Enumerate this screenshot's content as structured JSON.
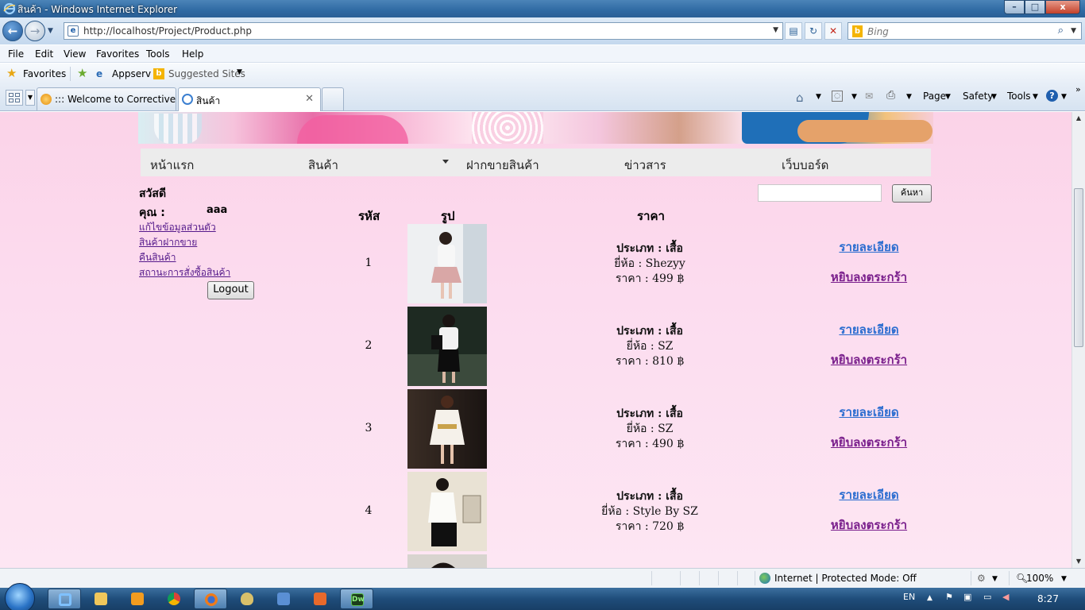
{
  "window": {
    "title": "สินค้า - Windows Internet Explorer",
    "min": "–",
    "max": "□",
    "close": "x"
  },
  "address": {
    "url": "http://localhost/Project/Product.php",
    "search_placeholder": "Bing"
  },
  "menu": [
    "File",
    "Edit",
    "View",
    "Favorites",
    "Tools",
    "Help"
  ],
  "favorites": {
    "label": "Favorites",
    "items": [
      "Appserv",
      "Suggested Sites"
    ]
  },
  "tabs": [
    {
      "label": "::: Welcome to Corrective ...",
      "active": false
    },
    {
      "label": "สินค้า",
      "active": true
    }
  ],
  "commandbar": {
    "page": "Page",
    "safety": "Safety",
    "tools": "Tools"
  },
  "site": {
    "nav": [
      "หน้าแรก",
      "สินค้า",
      "ฝากขายสินค้า",
      "ข่าวสาร",
      "เว็บบอร์ด"
    ],
    "greeting": "สวัสดี",
    "user_label": "คุณ :",
    "username": "aaa",
    "links": [
      "แก้ไขข้อมูลส่วนตัว",
      "สินค้าฝากขาย",
      "คืนสินค้า",
      "สถานะการสั่งซื้อสินค้า"
    ],
    "logout": "Logout",
    "search_button": "ค้นหา",
    "columns": [
      "รหัส",
      "รูป",
      "ราคา"
    ],
    "detail_label": "รายละเอียด",
    "cart_label": "หยิบลงตระกร้า",
    "products": [
      {
        "id": "1",
        "type": "ประเภท : เสื้อ",
        "brand": "ยี่ห้อ : Shezyy",
        "price": "ราคา : 499 ฿"
      },
      {
        "id": "2",
        "type": "ประเภท : เสื้อ",
        "brand": "ยี่ห้อ : SZ",
        "price": "ราคา : 810 ฿"
      },
      {
        "id": "3",
        "type": "ประเภท : เสื้อ",
        "brand": "ยี่ห้อ : SZ",
        "price": "ราคา : 490 ฿"
      },
      {
        "id": "4",
        "type": "ประเภท : เสื้อ",
        "brand": "ยี่ห้อ : Style By SZ",
        "price": "ราคา : 720 ฿"
      }
    ]
  },
  "status": {
    "zone": "Internet | Protected Mode: Off",
    "zoom": "100%"
  },
  "taskbar": {
    "lang": "EN",
    "time": "8:27"
  },
  "colors": {
    "page_bg": "#fcdcef",
    "nav_bg": "#ececec",
    "link_blue": "#2b6dd0",
    "link_purple": "#7a1f8c"
  }
}
